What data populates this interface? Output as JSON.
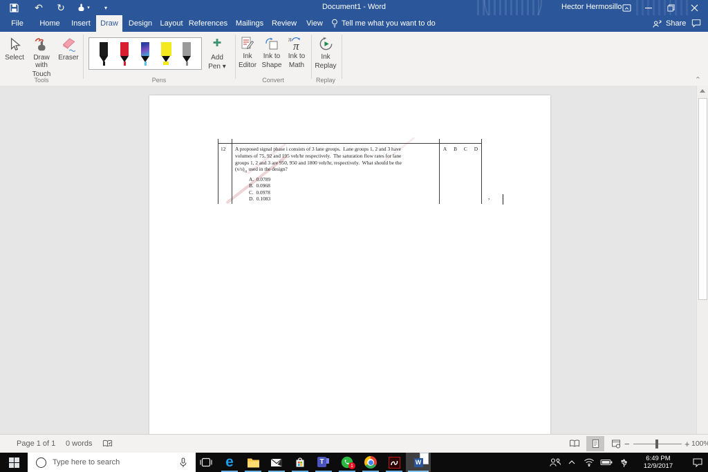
{
  "titlebar": {
    "title": "Document1 - Word",
    "user_name": "Hector Hermosillo",
    "undo_glyph": "↶",
    "redo_glyph": "↻",
    "dropdown_glyph": "▾"
  },
  "tabs": [
    {
      "label": "File"
    },
    {
      "label": "Home"
    },
    {
      "label": "Insert"
    },
    {
      "label": "Draw"
    },
    {
      "label": "Design"
    },
    {
      "label": "Layout"
    },
    {
      "label": "References"
    },
    {
      "label": "Mailings"
    },
    {
      "label": "Review"
    },
    {
      "label": "View"
    }
  ],
  "tell_me_text": "Tell me what you want to do",
  "share_label": "Share",
  "ribbon": {
    "tools_group_label": "Tools",
    "select_label": "Select",
    "draw_with_touch_line1": "Draw with",
    "draw_with_touch_line2": "Touch",
    "eraser_label": "Eraser",
    "pens_group_label": "Pens",
    "add_pen_line1": "Add",
    "add_pen_line2": "Pen ▾",
    "add_pen_plus": "✚",
    "convert_group_label": "Convert",
    "ink_editor_line1": "Ink",
    "ink_editor_line2": "Editor",
    "ink_to_shape_line1": "Ink to",
    "ink_to_shape_line2": "Shape",
    "ink_to_math_line1": "Ink to",
    "ink_to_math_line2": "Math",
    "replay_group_label": "Replay",
    "ink_replay_line1": "Ink",
    "ink_replay_line2": "Replay",
    "pi_glyph": "π",
    "collapse_glyph": "⌃"
  },
  "pens": [
    {
      "name": "black-pen",
      "body": "#1a1a1a",
      "tip": "#1a1a1a"
    },
    {
      "name": "red-pen",
      "body": "#d81f30",
      "tip": "#d81f30"
    },
    {
      "name": "galaxy-pen",
      "body": "galaxy",
      "tip": "#56c3e8"
    },
    {
      "name": "yellow-highlighter",
      "body": "#f4e81e",
      "tip": "#f4e81e"
    },
    {
      "name": "gray-pencil",
      "body": "#9b9b9b",
      "tip": "#8b8b8b"
    }
  ],
  "document": {
    "question_number": "12",
    "question_lines": [
      "A proposed signal phase i consists of 3 lane groups.  Lane groups 1, 2 and 3 have",
      "volumes of 75, 92 and 195 veh/hr respectively.  The saturation flow rates for lane",
      "groups 1, 2 and 3 are 950, 950 and 1800 veh/hr, respectively.  What should be the"
    ],
    "last_line_pre": "(v/s)",
    "last_line_sub": "ci",
    "last_line_post": " used in the design?",
    "options": [
      {
        "letter": "A.",
        "value": "0.0789"
      },
      {
        "letter": "B.",
        "value": "0.0968"
      },
      {
        "letter": "C.",
        "value": "0.0978"
      },
      {
        "letter": "D.",
        "value": "0.1083"
      }
    ],
    "answer_choices": [
      "A",
      "B",
      "C",
      "D"
    ],
    "trailing_mark": ","
  },
  "statusbar": {
    "page_info": "Page 1 of 1",
    "word_count": "0 words",
    "zoom_minus": "−",
    "zoom_plus": "+",
    "zoom_level": "100%"
  },
  "taskbar": {
    "search_placeholder": "Type here to search",
    "edge_letter": "e",
    "teams_letter": "T",
    "word_letter": "W",
    "whatsapp_badge": "1",
    "time": "6:49 PM",
    "date": "12/9/2017"
  },
  "colors": {
    "word_blue": "#2b579a",
    "ribbon_bg": "#f3f2f1",
    "taskbar_black": "#0c0c0c",
    "badge_red": "#e81123",
    "taskbar_underline": "#6cb2e2",
    "add_pen_green": "#3f9470"
  }
}
